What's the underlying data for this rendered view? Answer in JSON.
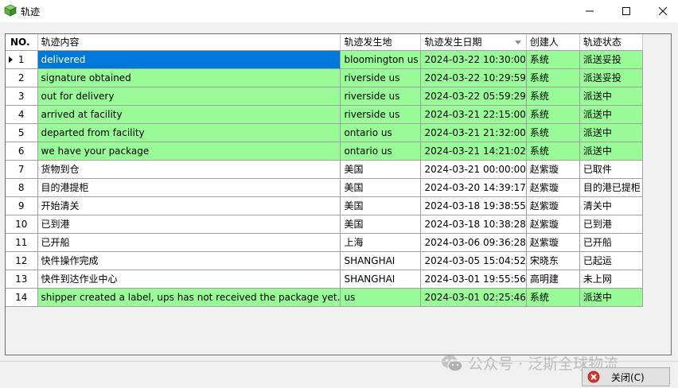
{
  "window": {
    "title": "轨迹",
    "accent_color": "#0078d7"
  },
  "grid": {
    "columns": [
      "NO.",
      "轨迹内容",
      "轨迹发生地",
      "轨迹发生日期",
      "创建人",
      "轨迹状态"
    ],
    "sorted_column": "轨迹发生日期",
    "selected_row": 1,
    "rows": [
      {
        "no": "1",
        "content": "delivered",
        "location": "bloomington us",
        "date": "2024-03-22 10:30:00",
        "creator": "系统",
        "status": "派送妥投",
        "highlight": true
      },
      {
        "no": "2",
        "content": "signature obtained",
        "location": "riverside us",
        "date": "2024-03-22 10:29:59",
        "creator": "系统",
        "status": "派送妥投",
        "highlight": true
      },
      {
        "no": "3",
        "content": "out for delivery",
        "location": "riverside us",
        "date": "2024-03-22 05:59:29",
        "creator": "系统",
        "status": "派送中",
        "highlight": true
      },
      {
        "no": "4",
        "content": "arrived at facility",
        "location": "riverside us",
        "date": "2024-03-21 22:15:00",
        "creator": "系统",
        "status": "派送中",
        "highlight": true
      },
      {
        "no": "5",
        "content": "departed from facility",
        "location": "ontario us",
        "date": "2024-03-21 21:32:00",
        "creator": "系统",
        "status": "派送中",
        "highlight": true
      },
      {
        "no": "6",
        "content": "we have your package",
        "location": "ontario us",
        "date": "2024-03-21 14:21:02",
        "creator": "系统",
        "status": "派送中",
        "highlight": true
      },
      {
        "no": "7",
        "content": "货物到仓",
        "location": "美国",
        "date": "2024-03-21 00:00:00",
        "creator": "赵紫璇",
        "status": "已取件",
        "highlight": false
      },
      {
        "no": "8",
        "content": "目的港提柜",
        "location": "美国",
        "date": "2024-03-20 14:39:17",
        "creator": "赵紫璇",
        "status": "目的港已提柜",
        "highlight": false
      },
      {
        "no": "9",
        "content": "开始清关",
        "location": "美国",
        "date": "2024-03-18 19:38:55",
        "creator": "赵紫璇",
        "status": "清关中",
        "highlight": false
      },
      {
        "no": "10",
        "content": "已到港",
        "location": "美国",
        "date": "2024-03-18 10:38:28",
        "creator": "赵紫璇",
        "status": "已到港",
        "highlight": false
      },
      {
        "no": "11",
        "content": "已开船",
        "location": "上海",
        "date": "2024-03-06 09:36:28",
        "creator": "赵紫璇",
        "status": "已开船",
        "highlight": false
      },
      {
        "no": "12",
        "content": "快件操作完成",
        "location": "SHANGHAI",
        "date": "2024-03-05 15:04:52",
        "creator": "宋晓东",
        "status": "已起运",
        "highlight": false
      },
      {
        "no": "13",
        "content": "快件到达作业中心",
        "location": "SHANGHAI",
        "date": "2024-03-01 19:55:56",
        "creator": "高明建",
        "status": "未上网",
        "highlight": false
      },
      {
        "no": "14",
        "content": "shipper created a label, ups has not received the package yet.",
        "location": " us",
        "date": "2024-03-01 02:25:46",
        "creator": "系统",
        "status": "派送中",
        "highlight": true
      }
    ]
  },
  "footer": {
    "close_button": "关闭(C)",
    "watermark": "公众号 · 泛斯全球物流"
  },
  "colors": {
    "highlight_green": "#98fb98",
    "selection_blue": "#0078d7"
  }
}
